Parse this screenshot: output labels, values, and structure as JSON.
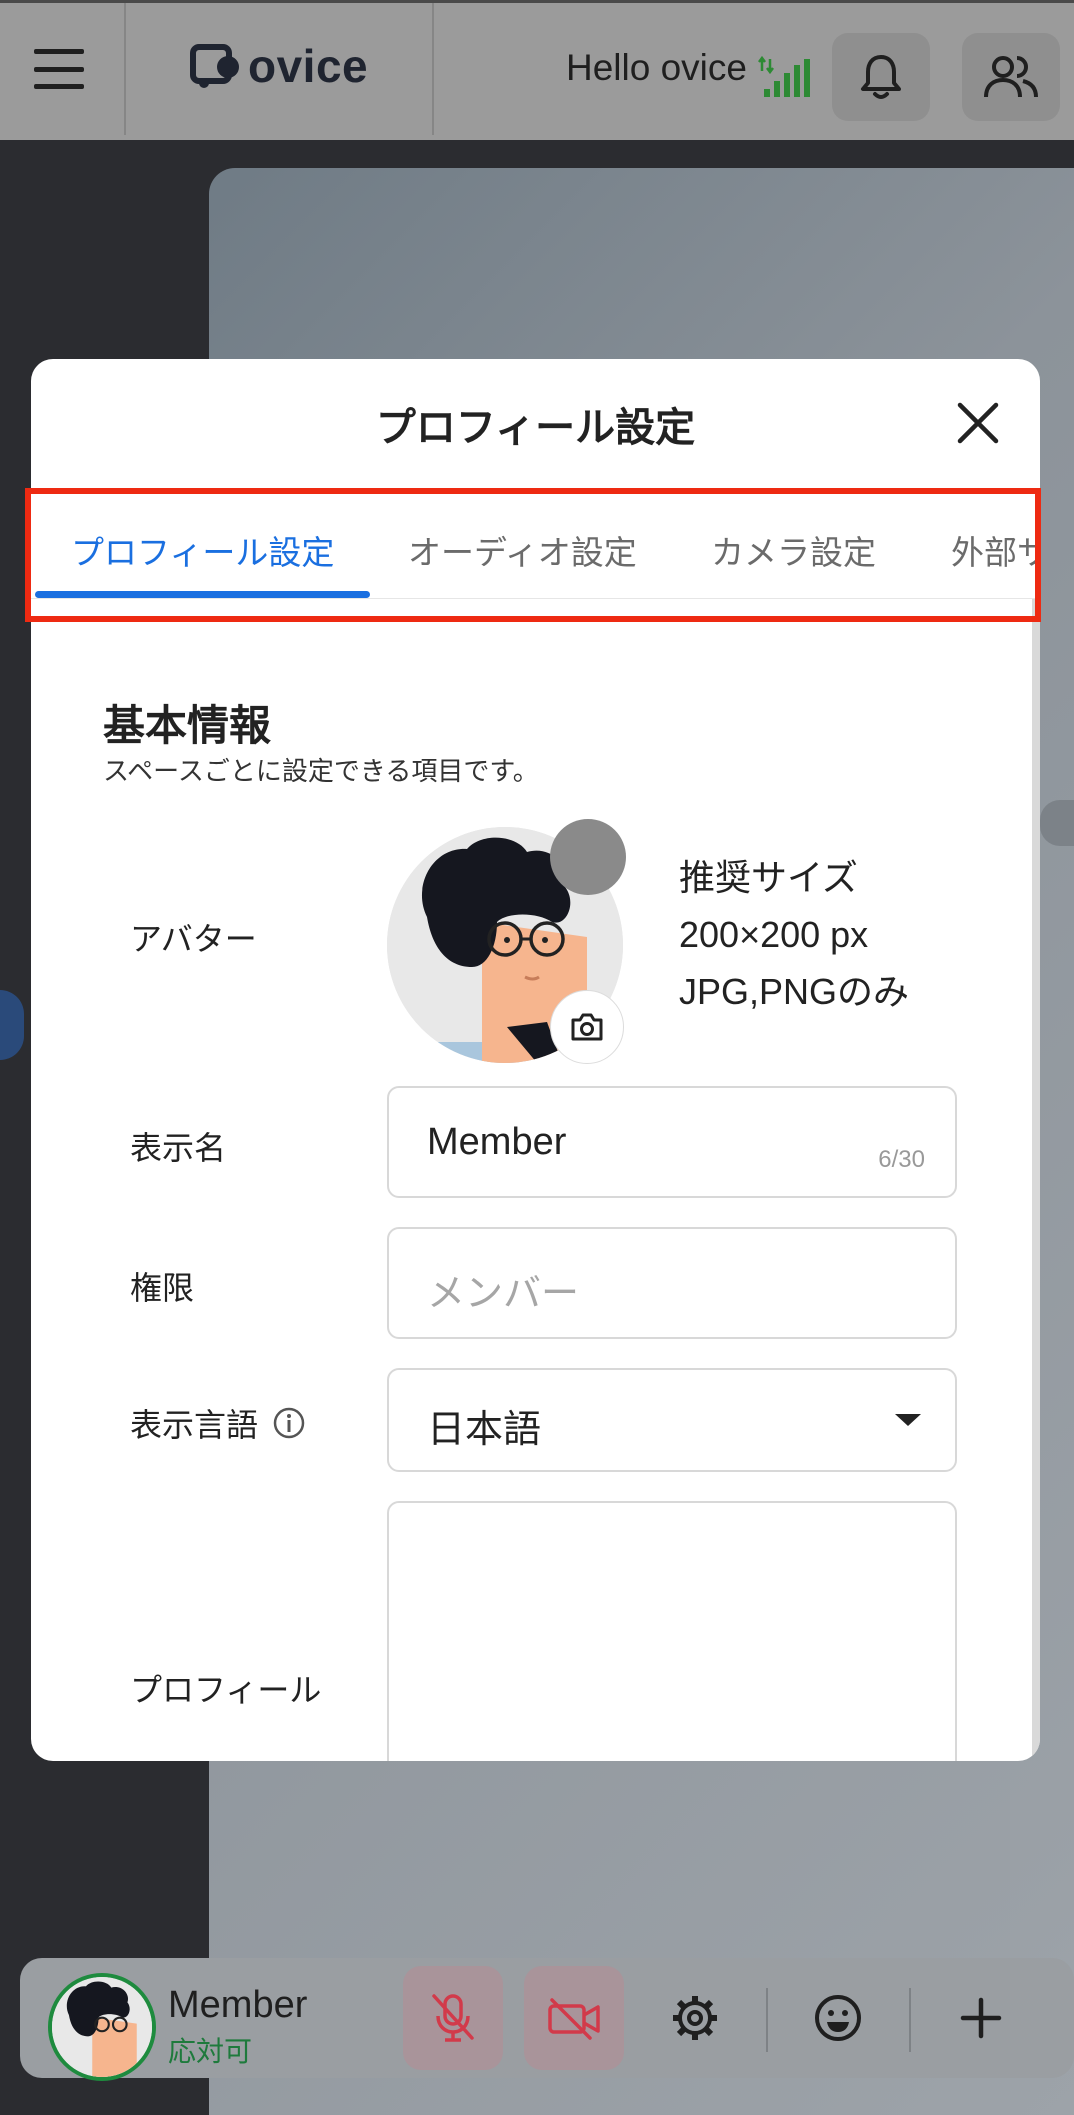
{
  "topbar": {
    "logo_text": "ovice",
    "greeting": "Hello ovice",
    "icons": [
      "menu-icon",
      "ovice-logo",
      "signal-icon",
      "bell-icon",
      "people-icon"
    ]
  },
  "modal": {
    "title": "プロフィール設定",
    "tabs": [
      {
        "label": "プロフィール設定",
        "active": true
      },
      {
        "label": "オーディオ設定",
        "active": false
      },
      {
        "label": "カメラ設定",
        "active": false
      },
      {
        "label": "外部サ",
        "active": false
      }
    ],
    "section": {
      "title": "基本情報",
      "subtitle": "スペースごとに設定できる項目です。"
    },
    "avatar": {
      "label": "アバター",
      "note": [
        "推奨サイズ",
        "200×200 px",
        "JPG,PNGのみ"
      ]
    },
    "display_name": {
      "label": "表示名",
      "value": "Member",
      "counter": "6/30"
    },
    "role": {
      "label": "権限",
      "placeholder": "メンバー"
    },
    "language": {
      "label": "表示言語",
      "value": "日本語"
    },
    "profile": {
      "label": "プロフィール",
      "value": ""
    }
  },
  "bottombar": {
    "name": "Member",
    "status": "応対可",
    "status_color": "#1e7a3c",
    "controls": [
      "mic-off-icon",
      "camera-off-icon",
      "gear-icon",
      "emoji-icon",
      "plus-icon"
    ]
  },
  "colors": {
    "accent": "#1a6fe0",
    "highlight": "#ee2a12"
  }
}
